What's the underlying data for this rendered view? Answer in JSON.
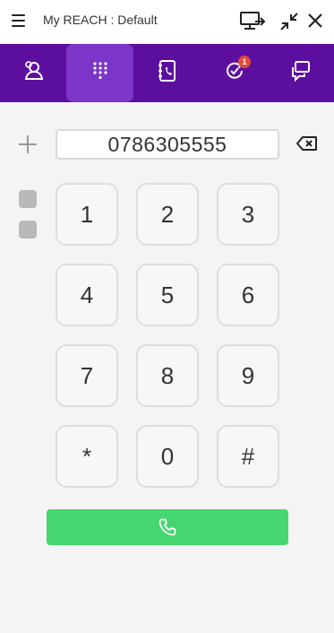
{
  "header": {
    "title": "My REACH : Default",
    "icons": [
      "menu-icon",
      "monitor-icon",
      "minimize-icon",
      "close-icon"
    ]
  },
  "nav": {
    "tabs": [
      {
        "icon": "contacts-icon",
        "active": false
      },
      {
        "icon": "dialpad-icon",
        "active": true
      },
      {
        "icon": "phonebook-icon",
        "active": false
      },
      {
        "icon": "history-icon",
        "active": false,
        "badge": "1"
      },
      {
        "icon": "chat-icon",
        "active": false
      }
    ]
  },
  "dialer": {
    "number": "0786305555",
    "keys": [
      "1",
      "2",
      "3",
      "4",
      "5",
      "6",
      "7",
      "8",
      "9",
      "*",
      "0",
      "#"
    ]
  },
  "colors": {
    "nav_bg": "#5c0f9e",
    "nav_active": "#7b35c9",
    "call_button": "#45d66f",
    "badge": "#e24a3a"
  }
}
